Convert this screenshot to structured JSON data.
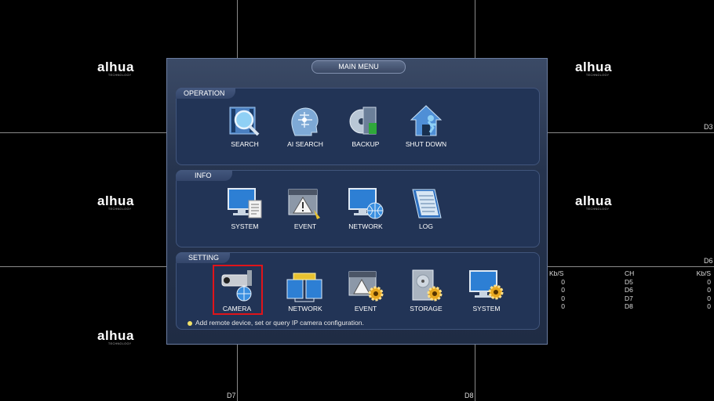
{
  "brand": {
    "logo_text": "alhua",
    "logo_sub": "TECHNOLOGY"
  },
  "channel_labels": {
    "d3": "D3",
    "d6": "D6",
    "d7": "D7",
    "d8": "D8"
  },
  "stats": {
    "headers": [
      "Kb/S",
      "CH",
      "Kb/S"
    ],
    "left_values": [
      "0",
      "0",
      "0",
      "0"
    ],
    "channels": [
      "D5",
      "D6",
      "D7",
      "D8"
    ],
    "right_values": [
      "0",
      "0",
      "0",
      "0"
    ]
  },
  "menu": {
    "title": "MAIN MENU",
    "sections": {
      "operation": {
        "label": "OPERATION",
        "items": [
          {
            "label": "SEARCH",
            "icon": "search-icon"
          },
          {
            "label": "AI SEARCH",
            "icon": "ai-search-icon"
          },
          {
            "label": "BACKUP",
            "icon": "backup-icon"
          },
          {
            "label": "SHUT DOWN",
            "icon": "shutdown-icon"
          }
        ]
      },
      "info": {
        "label": "INFO",
        "items": [
          {
            "label": "SYSTEM",
            "icon": "system-info-icon"
          },
          {
            "label": "EVENT",
            "icon": "event-info-icon"
          },
          {
            "label": "NETWORK",
            "icon": "network-info-icon"
          },
          {
            "label": "LOG",
            "icon": "log-icon"
          }
        ]
      },
      "setting": {
        "label": "SETTING",
        "items": [
          {
            "label": "CAMERA",
            "icon": "camera-icon",
            "selected": true
          },
          {
            "label": "NETWORK",
            "icon": "network-settings-icon"
          },
          {
            "label": "EVENT",
            "icon": "event-settings-icon"
          },
          {
            "label": "STORAGE",
            "icon": "storage-icon"
          },
          {
            "label": "SYSTEM",
            "icon": "system-settings-icon"
          }
        ]
      }
    },
    "hint": "Add remote device, set or query IP camera configuration."
  },
  "colors": {
    "selection": "#e0141a",
    "panel": "#223456",
    "accent": "#2d7fd4"
  }
}
